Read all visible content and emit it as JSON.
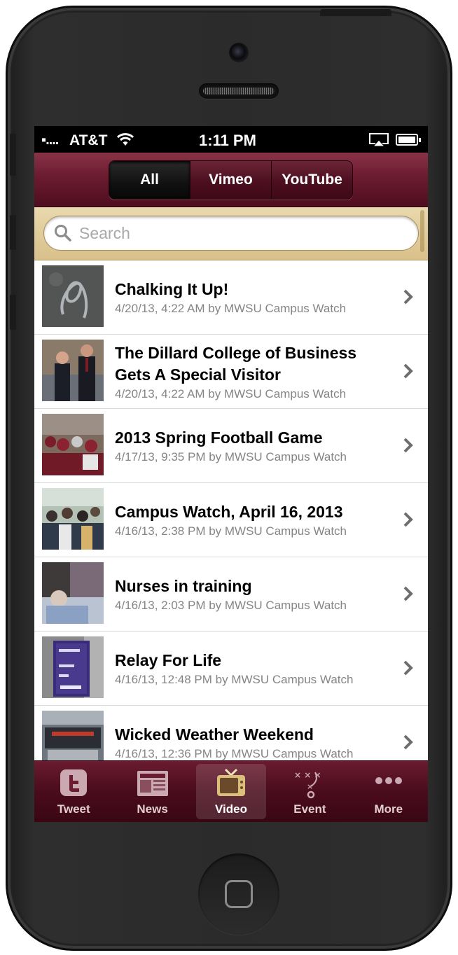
{
  "status_bar": {
    "signal": "▪....",
    "carrier": "AT&T",
    "time": "1:11 PM"
  },
  "nav": {
    "segments": [
      {
        "label": "All",
        "selected": true
      },
      {
        "label": "Vimeo",
        "selected": false
      },
      {
        "label": "YouTube",
        "selected": false
      }
    ]
  },
  "search": {
    "placeholder": "Search",
    "value": ""
  },
  "videos": [
    {
      "title": "Chalking It Up!",
      "meta": "4/20/13, 4:22 AM by MWSU Campus Watch",
      "thumb": "chalk"
    },
    {
      "title": "The Dillard College of Business Gets A Special Visitor",
      "meta": "4/20/13, 4:22 AM by MWSU Campus Watch",
      "thumb": "visitors"
    },
    {
      "title": "2013 Spring Football Game",
      "meta": "4/17/13, 9:35 PM by MWSU Campus Watch",
      "thumb": "football"
    },
    {
      "title": "Campus Watch, April 16, 2013",
      "meta": "4/16/13, 2:38 PM by MWSU Campus Watch",
      "thumb": "crowd"
    },
    {
      "title": "Nurses in training",
      "meta": "4/16/13, 2:03 PM by MWSU Campus Watch",
      "thumb": "nurses"
    },
    {
      "title": "Relay For Life",
      "meta": "4/16/13, 12:48 PM by MWSU Campus Watch",
      "thumb": "relay"
    },
    {
      "title": "Wicked Weather Weekend",
      "meta": "4/16/13, 12:36 PM by MWSU Campus Watch",
      "thumb": "weather"
    }
  ],
  "tabs": [
    {
      "label": "Tweet",
      "icon": "tweet-icon",
      "selected": false
    },
    {
      "label": "News",
      "icon": "news-icon",
      "selected": false
    },
    {
      "label": "Video",
      "icon": "tv-icon",
      "selected": true
    },
    {
      "label": "Event",
      "icon": "playbook-icon",
      "selected": false
    },
    {
      "label": "More",
      "icon": "more-dots-icon",
      "selected": false
    }
  ],
  "colors": {
    "brand_maroon": "#6a1b2f",
    "search_tan": "#e2cf9c",
    "meta_gray": "#858585"
  }
}
